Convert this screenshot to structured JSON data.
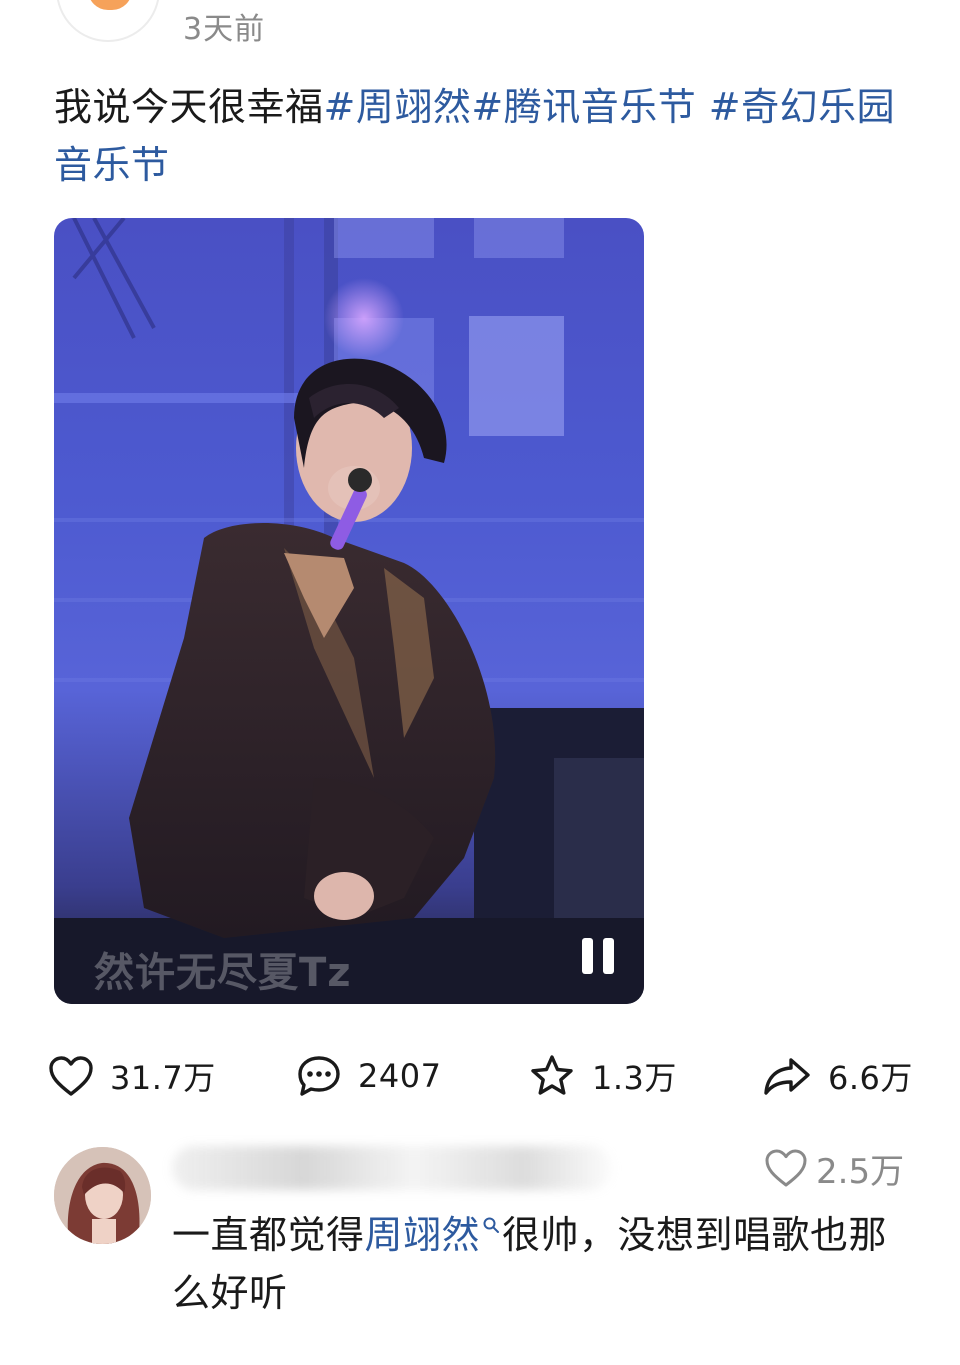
{
  "post": {
    "time": "3天前",
    "text_plain": "我说今天很幸福",
    "tags": [
      "#周翊然",
      "#腾讯音乐节",
      " #奇幻乐园音乐节"
    ]
  },
  "media": {
    "watermark": "然许无尽夏Tz",
    "state_icon": "pause-icon"
  },
  "actions": {
    "like": {
      "icon": "heart-icon",
      "count": "31.7万"
    },
    "comment": {
      "icon": "comment-bubble-icon",
      "count": "2407"
    },
    "favorite": {
      "icon": "star-icon",
      "count": "1.3万"
    },
    "share": {
      "icon": "share-arrow-icon",
      "count": "6.6万"
    }
  },
  "comment": {
    "like_count": "2.5万",
    "text_before": "一直都觉得",
    "link": "周翊然",
    "text_after": "很帅，没想到唱歌也那么好听"
  },
  "colors": {
    "tag": "#2d5a9f",
    "secondary_text": "#8a8a8a",
    "text": "#1a1a1a"
  }
}
